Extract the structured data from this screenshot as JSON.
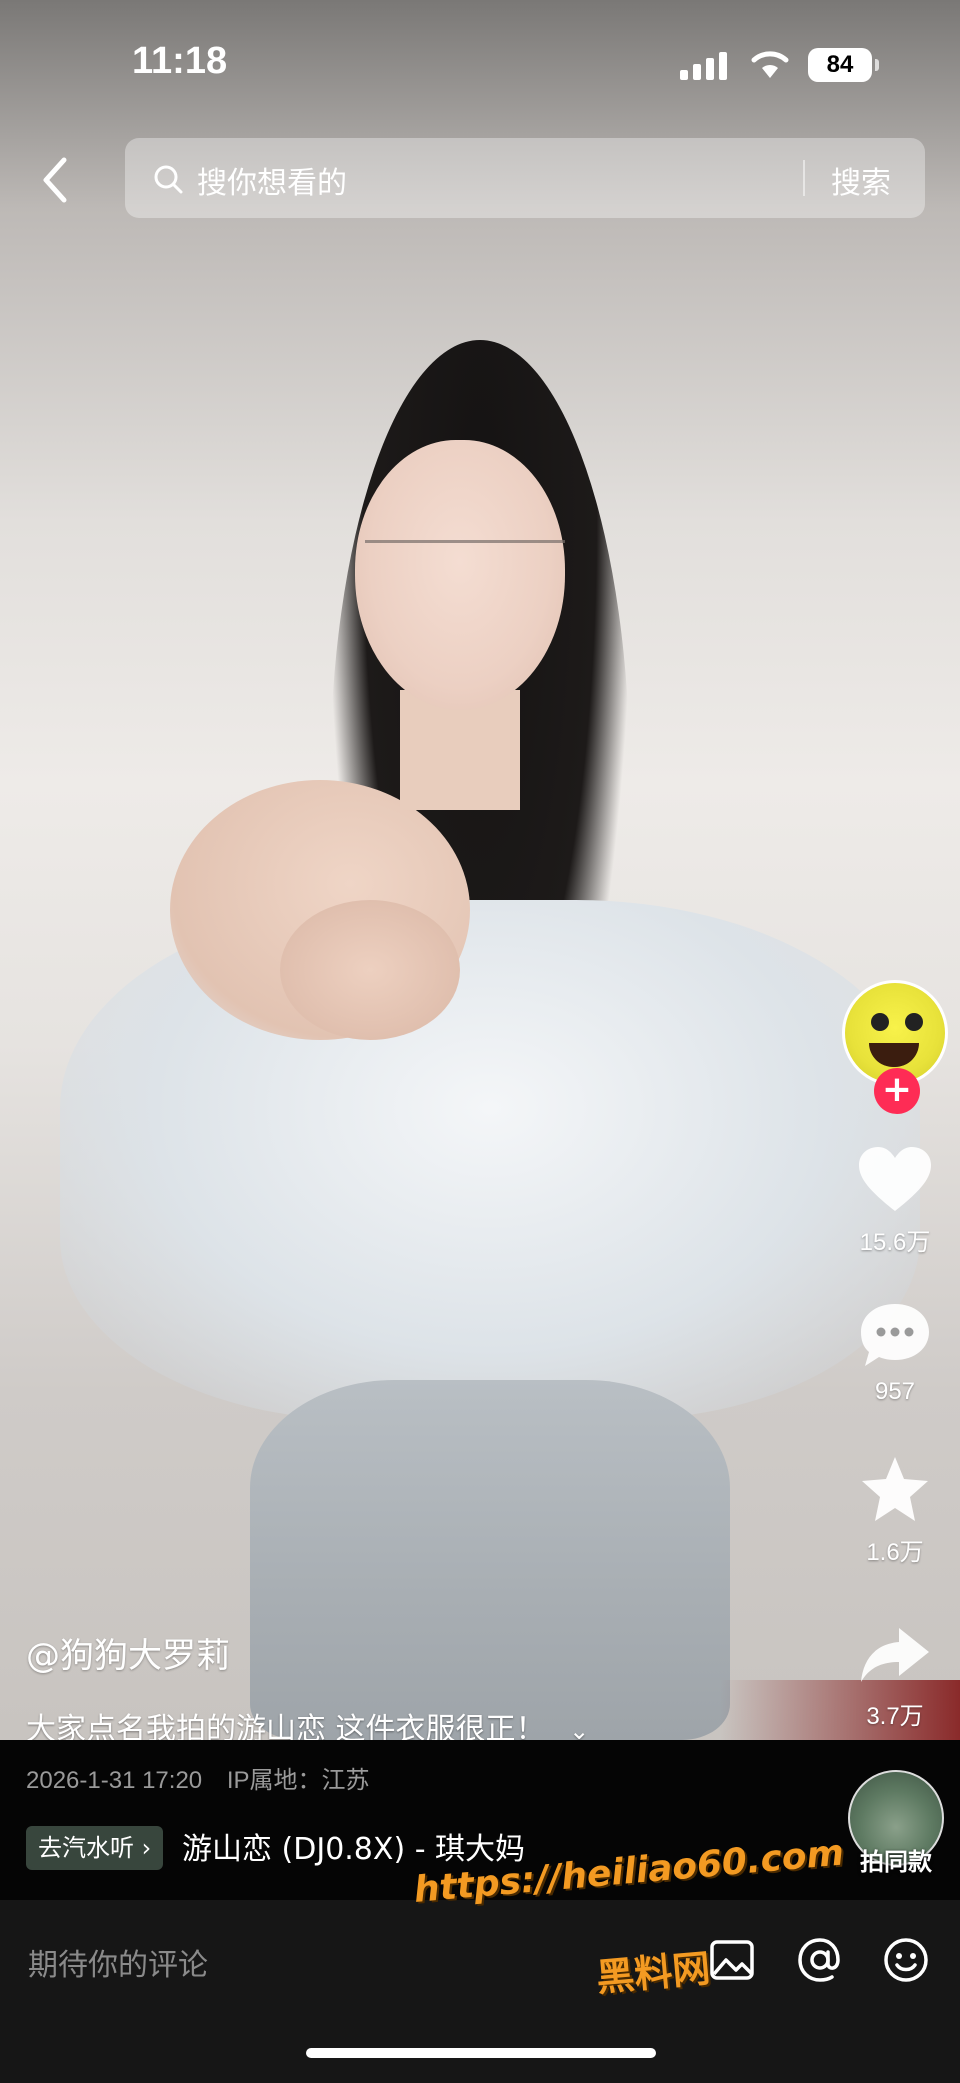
{
  "status_bar": {
    "time": "11:18",
    "battery": "84"
  },
  "search": {
    "placeholder": "搜你想看的",
    "submit_label": "搜索"
  },
  "rail": {
    "likes": "15.6万",
    "comments": "957",
    "favorites": "1.6万",
    "shares": "3.7万",
    "follow_symbol": "+"
  },
  "post": {
    "author": "@狗狗大罗莉",
    "description": "大家点名我拍的游山恋 这件衣服很正！",
    "expand_symbol": "⌄",
    "date": "2026-1-31 17:20",
    "ip_location": "IP属地：江苏"
  },
  "music": {
    "tag_label": "去汽水听 ›",
    "title": "游山恋 (DJ0.8X) - 琪大妈",
    "same_style_label": "拍同款"
  },
  "comment_bar": {
    "placeholder": "期待你的评论"
  },
  "watermark": {
    "line1": "https://heiliao60.com",
    "line2": "黑料网"
  },
  "icons": [
    "back-icon",
    "search-icon",
    "heart-icon",
    "comment-icon",
    "star-icon",
    "share-icon",
    "image-icon",
    "at-icon",
    "emoji-icon"
  ],
  "colors": {
    "follow": "#fe2c55",
    "watermark": "#f39a22"
  }
}
